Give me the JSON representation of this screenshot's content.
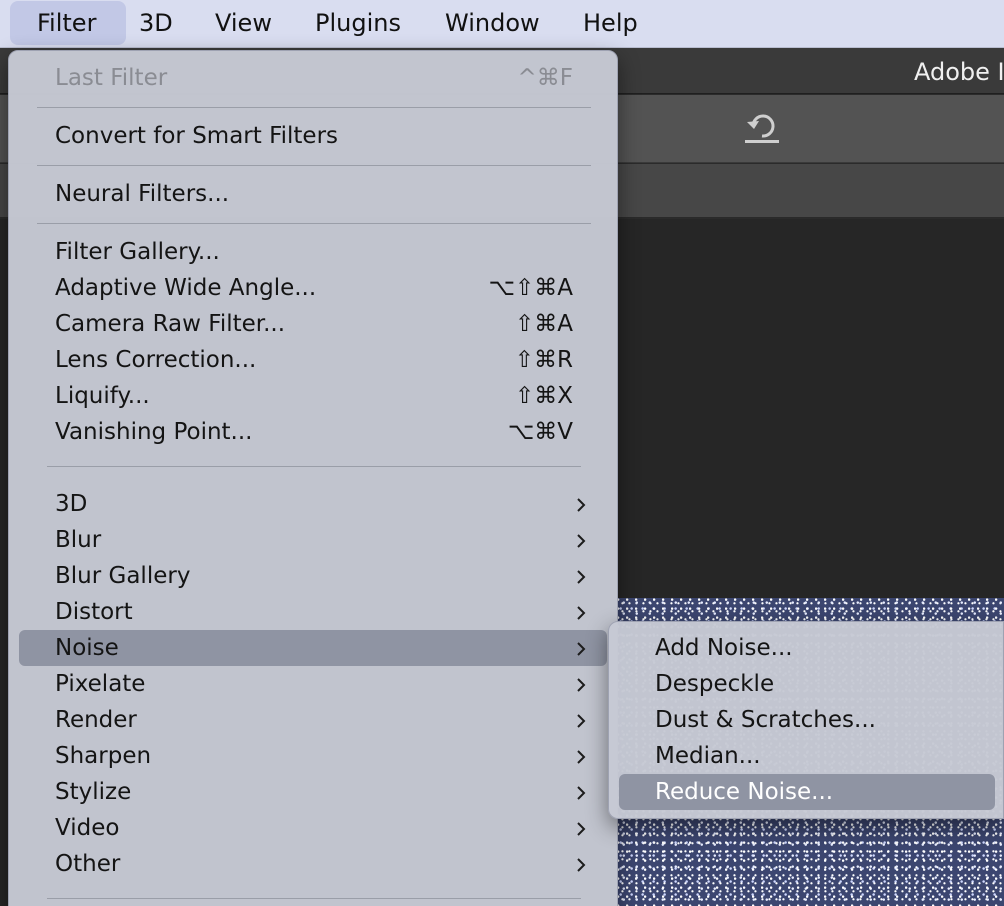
{
  "menubar": {
    "items": [
      {
        "label": "Filter"
      },
      {
        "label": "3D"
      },
      {
        "label": "View"
      },
      {
        "label": "Plugins"
      },
      {
        "label": "Window"
      },
      {
        "label": "Help"
      }
    ]
  },
  "app": {
    "title": "Adobe I"
  },
  "filter_menu": {
    "last_filter": {
      "label": "Last Filter",
      "shortcut": "^⌘F"
    },
    "convert_smart": {
      "label": "Convert for Smart Filters"
    },
    "neural": {
      "label": "Neural Filters..."
    },
    "gallery": {
      "label": "Filter Gallery..."
    },
    "adaptive": {
      "label": "Adaptive Wide Angle...",
      "shortcut": "⌥⇧⌘A"
    },
    "camera_raw": {
      "label": "Camera Raw Filter...",
      "shortcut": "⇧⌘A"
    },
    "lens": {
      "label": "Lens Correction...",
      "shortcut": "⇧⌘R"
    },
    "liquify": {
      "label": "Liquify...",
      "shortcut": "⇧⌘X"
    },
    "vanishing": {
      "label": "Vanishing Point...",
      "shortcut": "⌥⌘V"
    },
    "groups": [
      {
        "label": "3D"
      },
      {
        "label": "Blur"
      },
      {
        "label": "Blur Gallery"
      },
      {
        "label": "Distort"
      },
      {
        "label": "Noise"
      },
      {
        "label": "Pixelate"
      },
      {
        "label": "Render"
      },
      {
        "label": "Sharpen"
      },
      {
        "label": "Stylize"
      },
      {
        "label": "Video"
      },
      {
        "label": "Other"
      }
    ]
  },
  "noise_submenu": {
    "items": [
      {
        "label": "Add Noise..."
      },
      {
        "label": "Despeckle"
      },
      {
        "label": "Dust & Scratches..."
      },
      {
        "label": "Median..."
      },
      {
        "label": "Reduce Noise..."
      }
    ]
  },
  "colors": {
    "menubar_bg": "#d9ddf0",
    "menu_bg": "#c6c9d4",
    "highlight": "#8f94a3"
  }
}
